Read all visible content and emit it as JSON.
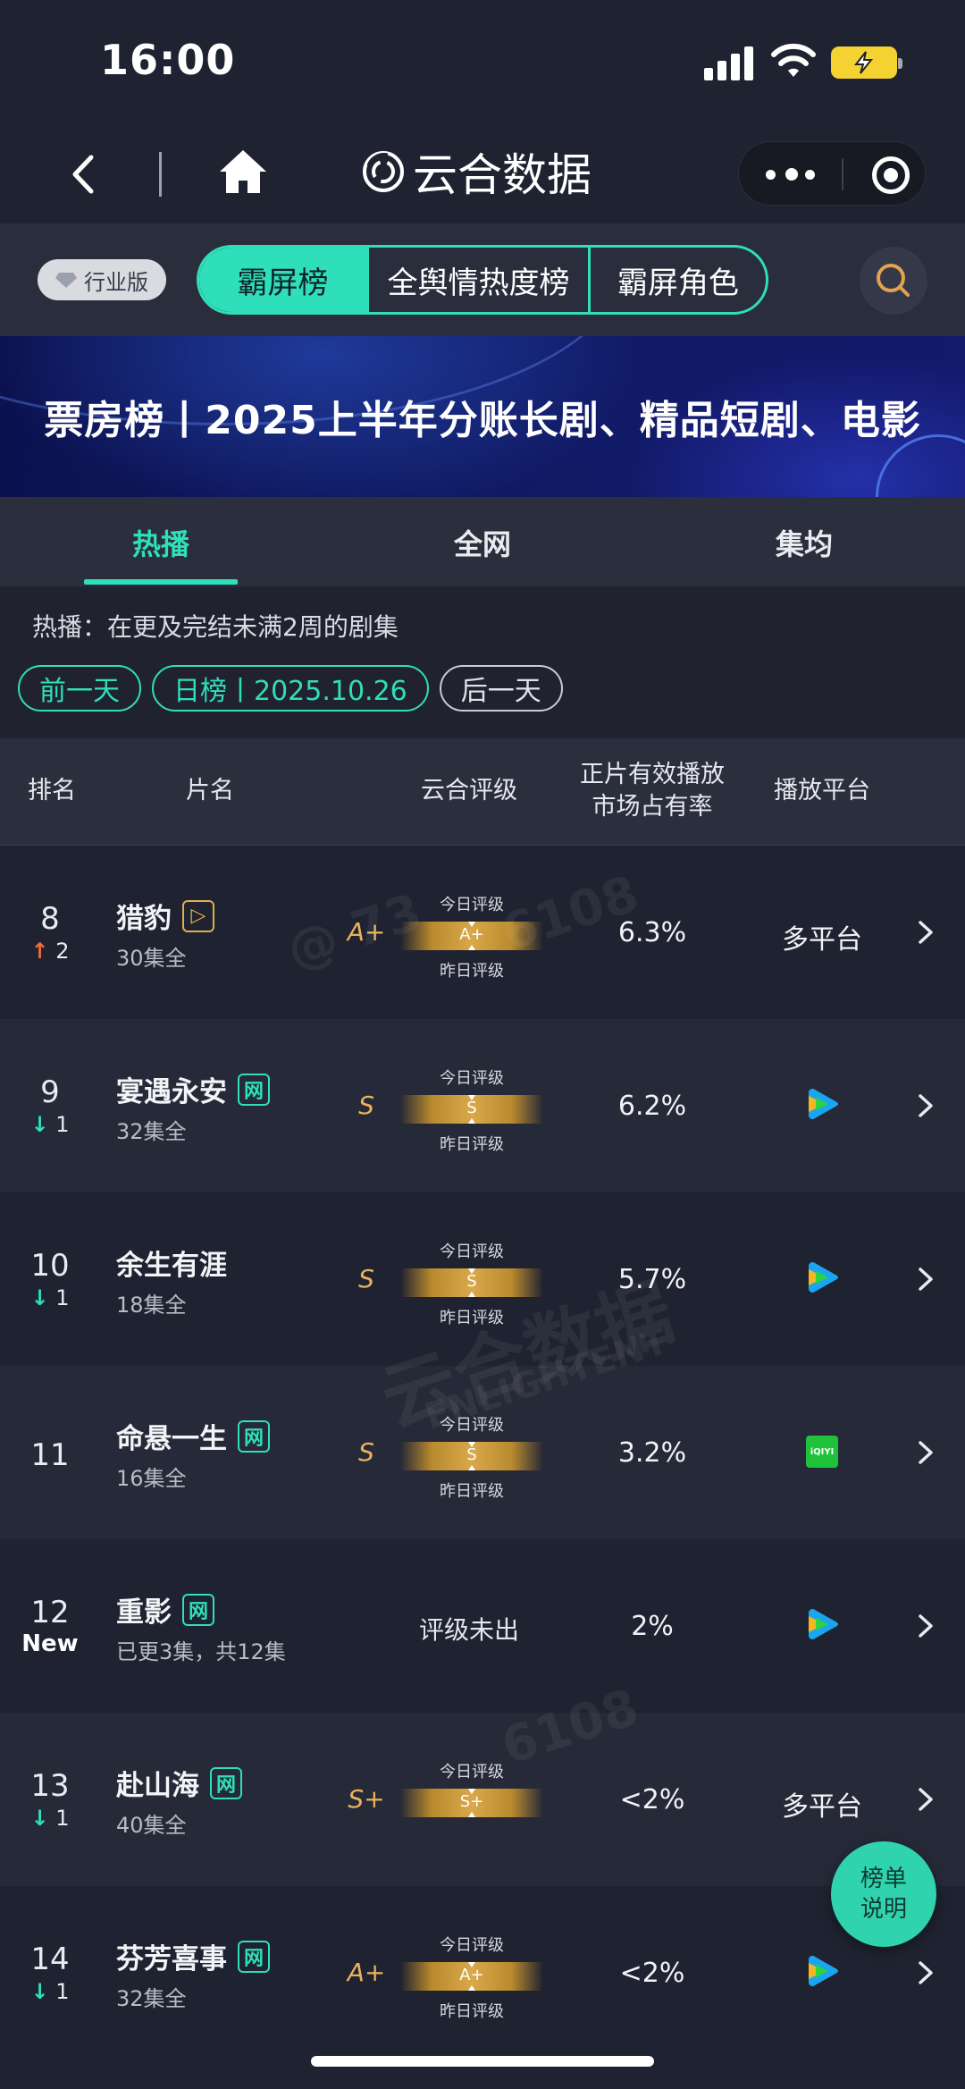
{
  "status_bar": {
    "time": "16:00"
  },
  "nav": {
    "title": "云合数据"
  },
  "top_tabs": {
    "edition_label": "行业版",
    "items": [
      "霸屏榜",
      "全舆情热度榜",
      "霸屏角色"
    ],
    "active_index": 0
  },
  "banner": {
    "text": "票房榜丨2025上半年分账长剧、精品短剧、电影"
  },
  "sub_tabs": {
    "items": [
      "热播",
      "全网",
      "集均"
    ],
    "active_index": 0
  },
  "info": {
    "description": "热播：在更及完结未满2周的剧集",
    "prev_day": "前一天",
    "date_chip": "日榜丨2025.10.26",
    "next_day": "后一天"
  },
  "table": {
    "headers": {
      "rank": "排名",
      "name": "片名",
      "grade": "云合评级",
      "share_line1": "正片有效播放",
      "share_line2": "市场占有率",
      "platform": "播放平台"
    },
    "grade_today_label": "今日评级",
    "grade_yesterday_label": "昨日评级",
    "rows": [
      {
        "rank": "8",
        "trend": "up",
        "change": "2",
        "title": "猎豹",
        "tag": "▷",
        "tag_style": "gold",
        "episodes": "30集全",
        "grade": "A+",
        "has_yesterday": true,
        "share": "6.3%",
        "platform": "多平台",
        "platform_icon": "text"
      },
      {
        "rank": "9",
        "trend": "down",
        "change": "1",
        "title": "宴遇永安",
        "tag": "网",
        "tag_style": "green",
        "episodes": "32集全",
        "grade": "S",
        "has_yesterday": true,
        "share": "6.2%",
        "platform": "",
        "platform_icon": "tencent-video-icon"
      },
      {
        "rank": "10",
        "trend": "down",
        "change": "1",
        "title": "余生有涯",
        "tag": "",
        "tag_style": "",
        "episodes": "18集全",
        "grade": "S",
        "has_yesterday": true,
        "share": "5.7%",
        "platform": "",
        "platform_icon": "tencent-video-icon"
      },
      {
        "rank": "11",
        "trend": "none",
        "change": "",
        "title": "命悬一生",
        "tag": "网",
        "tag_style": "green",
        "episodes": "16集全",
        "grade": "S",
        "has_yesterday": true,
        "share": "3.2%",
        "platform": "iQIYI",
        "platform_icon": "iqiyi-icon"
      },
      {
        "rank": "12",
        "trend": "new",
        "change": "New",
        "title": "重影",
        "tag": "网",
        "tag_style": "green",
        "episodes": "已更3集，共12集",
        "grade": "",
        "grade_text": "评级未出",
        "has_yesterday": false,
        "share": "2%",
        "platform": "",
        "platform_icon": "tencent-video-icon"
      },
      {
        "rank": "13",
        "trend": "down",
        "change": "1",
        "title": "赴山海",
        "tag": "网",
        "tag_style": "green",
        "episodes": "40集全",
        "grade": "S+",
        "has_yesterday": false,
        "share": "<2%",
        "platform": "多平台",
        "platform_icon": "text"
      },
      {
        "rank": "14",
        "trend": "down",
        "change": "1",
        "title": "芬芳喜事",
        "tag": "网",
        "tag_style": "green",
        "episodes": "32集全",
        "grade": "A+",
        "has_yesterday": true,
        "share": "<2%",
        "platform": "",
        "platform_icon": "tencent-video-icon"
      }
    ]
  },
  "watermarks": [
    "@ 73",
    "6108",
    "云合数据",
    "ENLIGHTENT",
    "6108"
  ],
  "float_button": {
    "line1": "榜单",
    "line2": "说明"
  },
  "colors": {
    "accent": "#2fdfb9",
    "background": "#1f2230",
    "grade_gold": "#eab25e",
    "up": "#f26a3c"
  }
}
